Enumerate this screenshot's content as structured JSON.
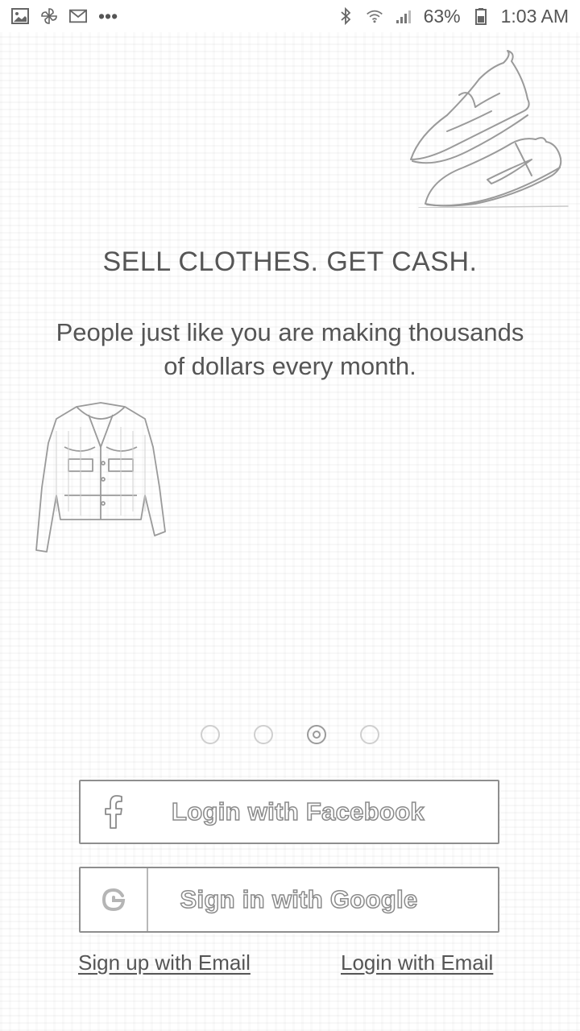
{
  "status_bar": {
    "notification_icons": [
      "image-icon",
      "pinwheel-icon",
      "gmail-icon"
    ],
    "more": "•••",
    "battery_percent": "63%",
    "time": "1:03 AM"
  },
  "onboarding": {
    "headline": "SELL CLOTHES. GET CASH.",
    "subtext": "People just like you are making thousands of dollars every month.",
    "page_count": 4,
    "active_page": 3
  },
  "auth": {
    "facebook_label": "Login with Facebook",
    "google_label": "Sign in with Google",
    "signup_email_label": "Sign up with Email",
    "login_email_label": "Login with Email"
  }
}
